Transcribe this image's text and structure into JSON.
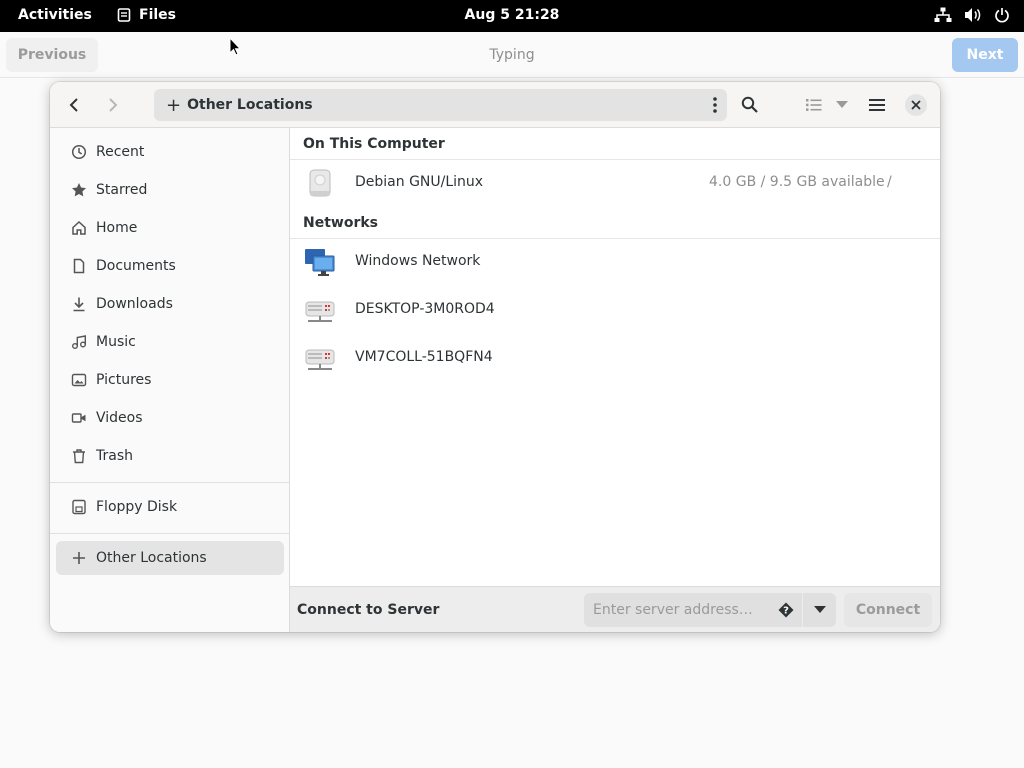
{
  "topbar": {
    "activities": "Activities",
    "app_name": "Files",
    "clock": "Aug 5  21:28",
    "tray_icons": [
      "network-icon",
      "volume-icon",
      "power-icon"
    ]
  },
  "assistant": {
    "previous_label": "Previous",
    "title": "Typing",
    "next_label": "Next"
  },
  "header": {
    "location": "Other Locations"
  },
  "sidebar": {
    "items": [
      {
        "label": "Recent",
        "icon": "clock-icon"
      },
      {
        "label": "Starred",
        "icon": "star-icon"
      },
      {
        "label": "Home",
        "icon": "home-icon"
      },
      {
        "label": "Documents",
        "icon": "document-icon"
      },
      {
        "label": "Downloads",
        "icon": "download-icon"
      },
      {
        "label": "Music",
        "icon": "music-icon"
      },
      {
        "label": "Pictures",
        "icon": "picture-icon"
      },
      {
        "label": "Videos",
        "icon": "video-icon"
      },
      {
        "label": "Trash",
        "icon": "trash-icon"
      },
      {
        "label": "Floppy Disk",
        "icon": "floppy-icon"
      },
      {
        "label": "Other Locations",
        "icon": "plus-icon",
        "active": true
      }
    ]
  },
  "main": {
    "on_this_computer": "On This Computer",
    "computer_rows": [
      {
        "name": "Debian GNU/Linux",
        "space": "4.0 GB / 9.5 GB available",
        "mount": "/"
      }
    ],
    "networks": "Networks",
    "network_rows": [
      {
        "name": "Windows Network"
      },
      {
        "name": "DESKTOP-3M0ROD4"
      },
      {
        "name": "VM7COLL-51BQFN4"
      }
    ]
  },
  "actionbar": {
    "label": "Connect to Server",
    "placeholder": "Enter server address…",
    "connect_label": "Connect"
  },
  "colors": {
    "accent_next": "#a4c8f0",
    "topbar": "#000000"
  }
}
